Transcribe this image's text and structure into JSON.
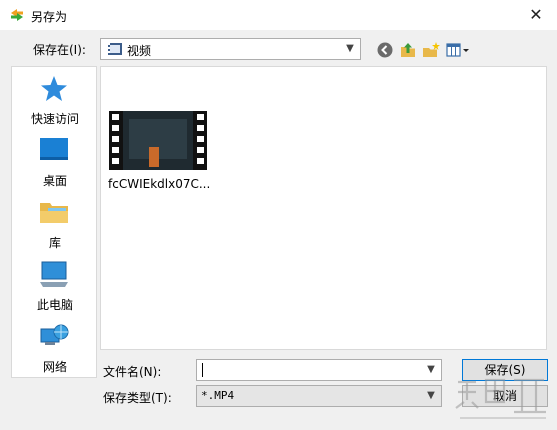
{
  "window": {
    "title": "另存为",
    "close_glyph": "✕"
  },
  "look_in": {
    "label": "保存在(I):",
    "value": "视频"
  },
  "toolbar": {
    "icons": [
      "back-icon",
      "up-folder-icon",
      "new-folder-icon",
      "view-menu-icon"
    ]
  },
  "places": [
    {
      "label": "快速访问",
      "icon": "star-icon"
    },
    {
      "label": "桌面",
      "icon": "desktop-icon"
    },
    {
      "label": "库",
      "icon": "library-icon"
    },
    {
      "label": "此电脑",
      "icon": "computer-icon"
    },
    {
      "label": "网络",
      "icon": "network-icon"
    }
  ],
  "files": [
    {
      "name": "fcCWIEkdlx07C...",
      "icon": "video-thumbnail"
    }
  ],
  "filename": {
    "label": "文件名(N):",
    "value": ""
  },
  "filetype": {
    "label": "保存类型(T):",
    "value": "*.MP4"
  },
  "buttons": {
    "save": "保存(S)",
    "cancel": "取消"
  },
  "colors": {
    "accent": "#0078d7",
    "panel": "#f0f0f0",
    "border": "#adadad"
  }
}
